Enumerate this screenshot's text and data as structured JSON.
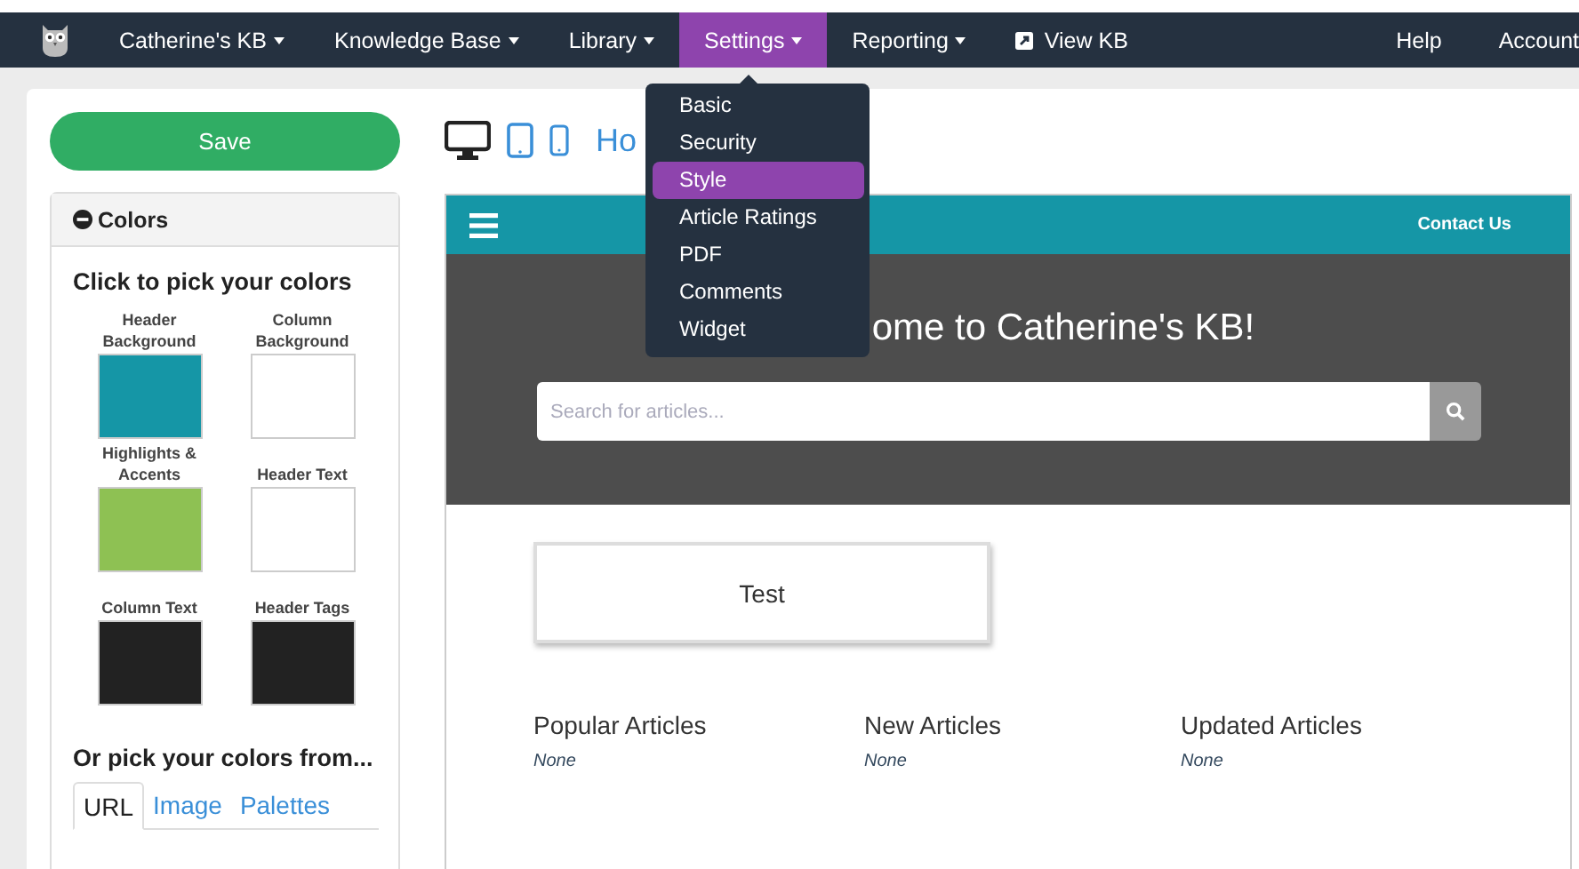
{
  "nav": {
    "items": [
      {
        "label": "Catherine's KB",
        "kind": "menu",
        "selected": false
      },
      {
        "label": "Knowledge Base",
        "kind": "menu",
        "selected": false
      },
      {
        "label": "Library",
        "kind": "menu",
        "selected": false
      },
      {
        "label": "Settings",
        "kind": "menu",
        "selected": true
      },
      {
        "label": "Reporting",
        "kind": "menu",
        "selected": false
      },
      {
        "label": "View KB",
        "kind": "link",
        "selected": false
      }
    ],
    "right_items": [
      {
        "label": "Help"
      },
      {
        "label": "Account"
      }
    ]
  },
  "dropdown": {
    "items": [
      {
        "label": "Basic",
        "selected": false
      },
      {
        "label": "Security",
        "selected": false
      },
      {
        "label": "Style",
        "selected": true
      },
      {
        "label": "Article Ratings",
        "selected": false
      },
      {
        "label": "PDF",
        "selected": false
      },
      {
        "label": "Comments",
        "selected": false
      },
      {
        "label": "Widget",
        "selected": false
      }
    ]
  },
  "sidebar": {
    "save_button": "Save",
    "colors_panel": {
      "title": "Colors",
      "expanded": true,
      "heading": "Click to pick your colors",
      "swatches": [
        {
          "label": "Header Background",
          "color": "#1596a6"
        },
        {
          "label": "Column Background",
          "color": "#ffffff"
        },
        {
          "label": "Highlights & Accents",
          "color": "#8ec153"
        },
        {
          "label": "Header Text",
          "color": "#ffffff"
        },
        {
          "label": "Column Text",
          "color": "#222222"
        },
        {
          "label": "Header Tags",
          "color": "#222222"
        }
      ],
      "source_heading": "Or pick your colors from...",
      "source_tabs": [
        {
          "label": "URL",
          "selected": true
        },
        {
          "label": "Image",
          "selected": false
        },
        {
          "label": "Palettes",
          "selected": false
        }
      ]
    }
  },
  "preview": {
    "devices": [
      {
        "kind": "desktop",
        "selected": true
      },
      {
        "kind": "tablet",
        "selected": false
      },
      {
        "kind": "phone",
        "selected": false
      }
    ],
    "page_link": "Ho",
    "site": {
      "contact_link": "Contact Us",
      "title": "ome to Catherine's KB!",
      "search": {
        "placeholder": "Search for articles..."
      },
      "featured_button": "Test",
      "sections": [
        {
          "title": "Popular Articles",
          "empty_text": "None"
        },
        {
          "title": "New Articles",
          "empty_text": "None"
        },
        {
          "title": "Updated Articles",
          "empty_text": "None"
        }
      ]
    }
  }
}
